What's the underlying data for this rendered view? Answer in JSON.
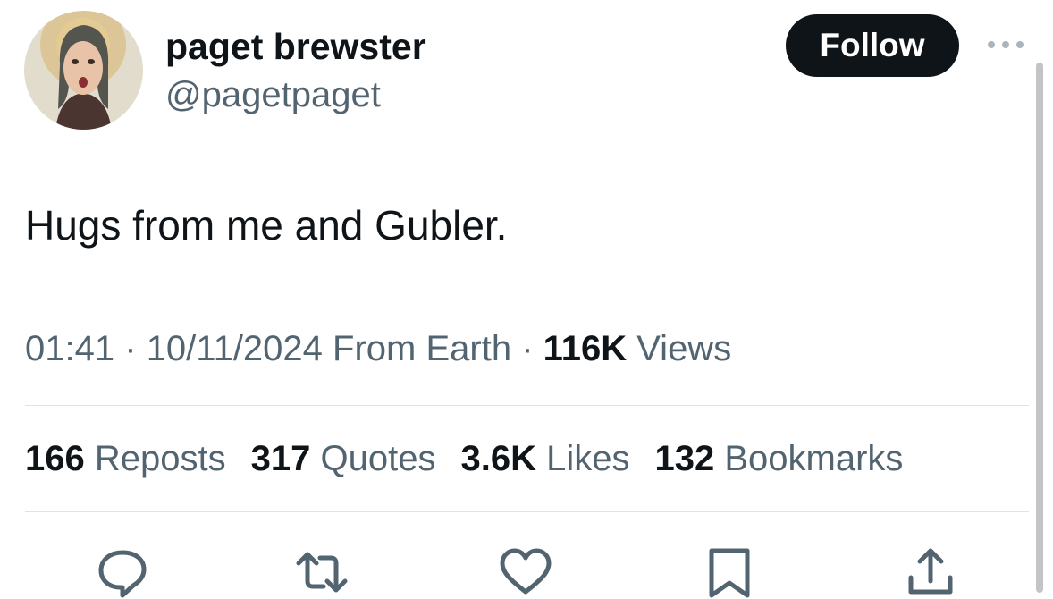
{
  "user": {
    "display_name": "paget brewster",
    "handle": "@pagetpaget"
  },
  "follow_button": {
    "label": "Follow"
  },
  "tweet": {
    "text": "Hugs from me and Gubler.",
    "time": "01:41",
    "date": "10/11/2024",
    "source": "From Earth",
    "separator": "·",
    "views_count": "116K",
    "views_label": "Views"
  },
  "stats": [
    {
      "count": "166",
      "label": "Reposts"
    },
    {
      "count": "317",
      "label": "Quotes"
    },
    {
      "count": "3.6K",
      "label": "Likes"
    },
    {
      "count": "132",
      "label": "Bookmarks"
    }
  ],
  "actions": [
    {
      "icon": "reply-icon"
    },
    {
      "icon": "repost-icon"
    },
    {
      "icon": "like-icon"
    },
    {
      "icon": "bookmark-icon"
    },
    {
      "icon": "share-icon"
    }
  ],
  "more_icon": "more-options-icon",
  "colors": {
    "primary_text": "#0f1419",
    "secondary_text": "#536471",
    "button_bg": "#0f1419",
    "divider": "#dfe3e6"
  }
}
